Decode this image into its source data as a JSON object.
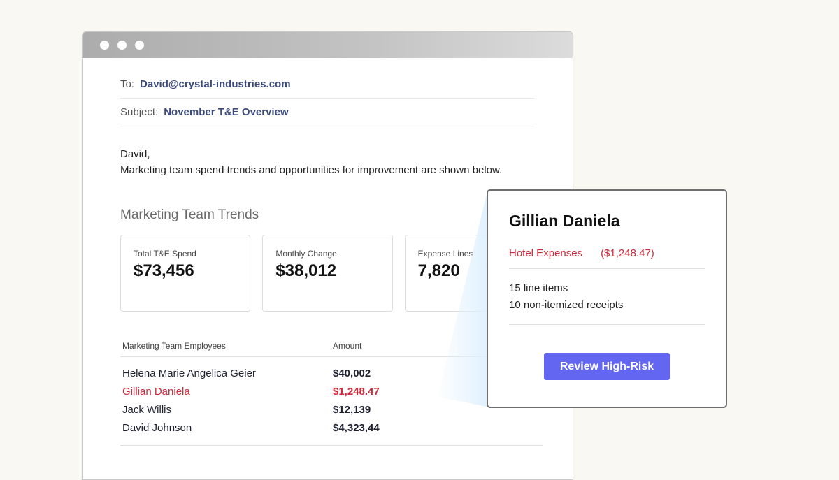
{
  "email": {
    "to_label": "To:",
    "to_value": "David@crystal-industries.com",
    "subject_label": "Subject:",
    "subject_value": "November T&E Overview",
    "greeting": "David,",
    "body": "Marketing team spend trends and opportunities for improvement are shown below."
  },
  "trends": {
    "title": "Marketing Team Trends",
    "cards": [
      {
        "label": "Total T&E Spend",
        "value": "$73,456"
      },
      {
        "label": "Monthly Change",
        "value": "$38,012"
      },
      {
        "label": "Expense Lines",
        "value": "7,820"
      }
    ]
  },
  "table": {
    "headers": [
      "Marketing Team Employees",
      "Amount"
    ],
    "rows": [
      {
        "name": "Helena Marie Angelica Geier",
        "amount": "$40,002"
      },
      {
        "name": "Gillian Daniela",
        "amount": "$1,248.47"
      },
      {
        "name": "Jack Willis",
        "amount": "$12,139"
      },
      {
        "name": "David Johnson",
        "amount": "$4,323,44"
      }
    ]
  },
  "popup": {
    "name": "Gillian Daniela",
    "expense_type": "Hotel Expenses",
    "expense_amount": "($1,248.47)",
    "line_items": "15 line items",
    "receipts": "10 non-itemized receipts",
    "button_label": "Review High-Risk"
  },
  "colors": {
    "accent": "#6366f1",
    "alert": "#cc2a3a",
    "link": "#3a4a7a"
  }
}
